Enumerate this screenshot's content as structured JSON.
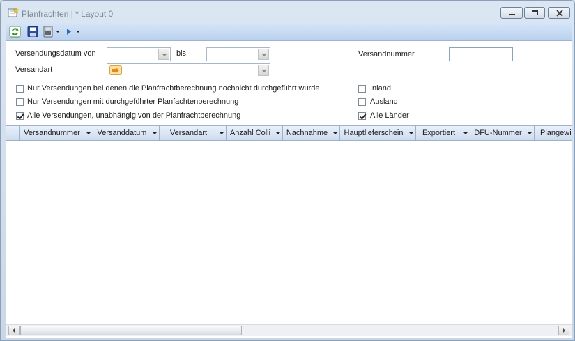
{
  "window": {
    "title": "Planfrachten | * Layout 0"
  },
  "toolbar": {
    "items": [
      "refresh-icon",
      "save-icon",
      "calculator-icon",
      "play-icon"
    ]
  },
  "filters": {
    "date_from_label": "Versendungsdatum von",
    "date_from_value": "",
    "date_to_label": "bis",
    "date_to_value": "",
    "shipment_number_label": "Versandnummer",
    "shipment_number_value": "",
    "shipping_type_label": "Versandart",
    "shipping_type_value": ""
  },
  "options": {
    "left": [
      {
        "label": "Nur Versendungen bei denen die Planfrachtberechnung nochnicht durchgeführt wurde",
        "checked": false
      },
      {
        "label": "Nur Versendungen mit durchgeführter Planfachtenberechnung",
        "checked": false
      },
      {
        "label": "Alle Versendungen, unabhängig von der Planfrachtberechnung",
        "checked": true
      }
    ],
    "right": [
      {
        "label": "Inland",
        "checked": false
      },
      {
        "label": "Ausland",
        "checked": false
      },
      {
        "label": "Alle Länder",
        "checked": true
      }
    ]
  },
  "grid": {
    "columns": [
      "Versandnummer",
      "Versanddatum",
      "Versandart",
      "Anzahl Colli",
      "Nachnahme",
      "Hauptlieferschein",
      "Exportiert",
      "DFÜ-Nummer",
      "Plangewi"
    ],
    "rows": []
  }
}
